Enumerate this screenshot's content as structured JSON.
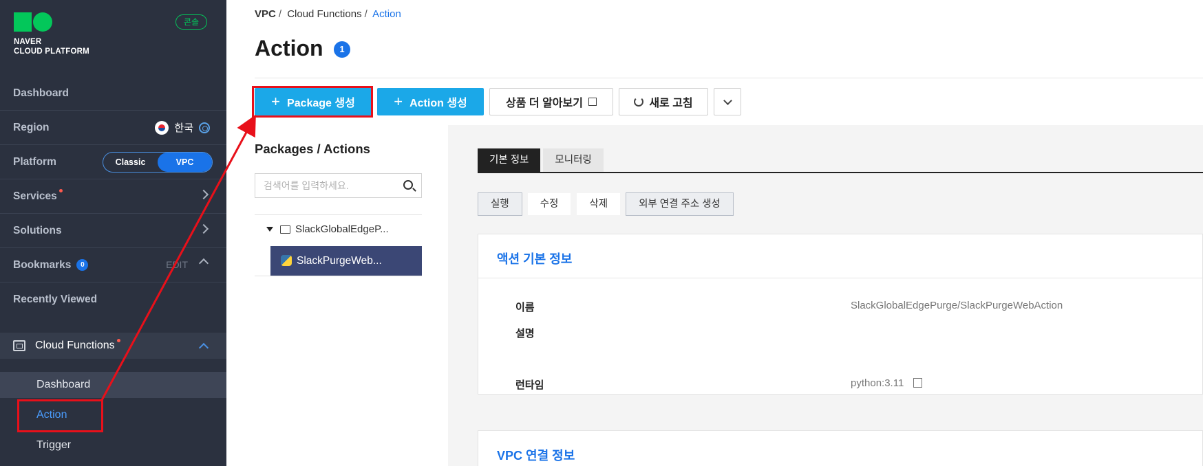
{
  "sidebar": {
    "logo_line1": "NAVER",
    "logo_line2": "CLOUD PLATFORM",
    "console_badge": "콘솔",
    "dashboard": "Dashboard",
    "region_label": "Region",
    "region_value": "한국",
    "platform_label": "Platform",
    "platform_options": [
      "Classic",
      "VPC"
    ],
    "platform_selected": "VPC",
    "services": "Services",
    "solutions": "Solutions",
    "bookmarks": "Bookmarks",
    "bookmarks_count": "0",
    "bookmarks_edit": "EDIT",
    "recently_viewed": "Recently Viewed",
    "cloud_functions": "Cloud Functions",
    "sub_items": [
      "Dashboard",
      "Action",
      "Trigger"
    ]
  },
  "breadcrumb": [
    "VPC",
    "Cloud Functions",
    "Action"
  ],
  "page": {
    "title": "Action",
    "count": "1"
  },
  "toolbar": {
    "package_create": "Package 생성",
    "action_create": "Action 생성",
    "learn_more": "상품 더 알아보기",
    "refresh": "새로 고침"
  },
  "tree": {
    "title": "Packages / Actions",
    "search_placeholder": "검색어를 입력하세요.",
    "package_name": "SlackGlobalEdgeP...",
    "action_name": "SlackPurgeWeb..."
  },
  "detail": {
    "tabs": [
      "기본 정보",
      "모니터링"
    ],
    "active_tab": "기본 정보",
    "action_buttons": [
      "실행",
      "수정",
      "삭제",
      "외부 연결 주소 생성"
    ],
    "basic_info_title": "액션 기본 정보",
    "fields": [
      {
        "label": "이름",
        "value": "SlackGlobalEdgePurge/SlackPurgeWebAction"
      },
      {
        "label": "설명",
        "value": ""
      },
      {
        "label": "런타임",
        "value": "python:3.11"
      }
    ],
    "vpc_title": "VPC 연결 정보"
  },
  "colors": {
    "sidebar_bg": "#2b313f",
    "brand_green": "#03c75a",
    "primary_button": "#1ba8e8",
    "link_blue": "#1a73e8",
    "annotation_red": "#e8101a"
  }
}
